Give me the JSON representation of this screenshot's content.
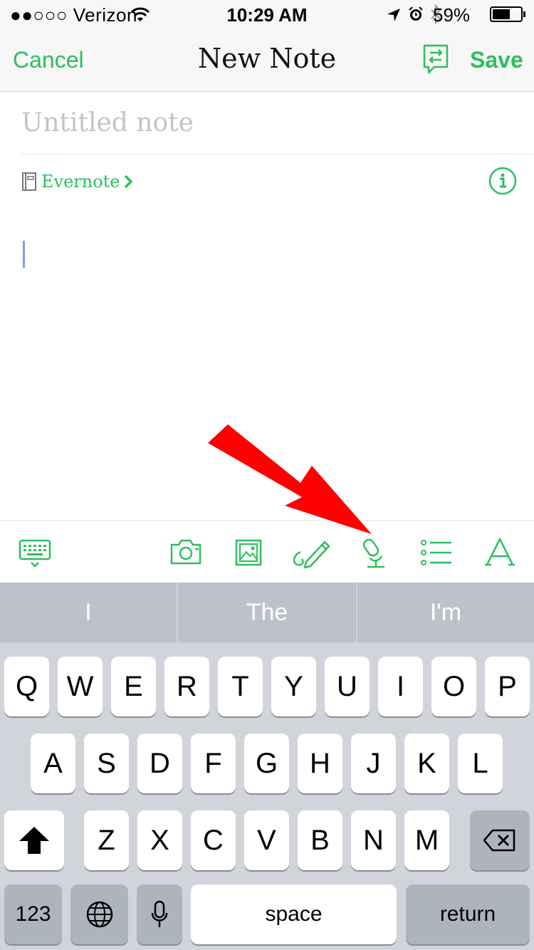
{
  "status_bar": {
    "carrier": "●●○○○ Verizon",
    "time": "10:29 AM",
    "battery": "59%"
  },
  "nav": {
    "cancel": "Cancel",
    "title": "New Note",
    "save": "Save"
  },
  "note": {
    "title_placeholder": "Untitled note",
    "title_value": "",
    "notebook": "Evernote"
  },
  "toolbar": {
    "icons": [
      "keyboard-icon",
      "camera-icon",
      "image-icon",
      "sketch-icon",
      "audio-record-icon",
      "list-icon",
      "text-format-icon"
    ]
  },
  "keyboard": {
    "predictions": [
      "I",
      "The",
      "I'm"
    ],
    "row1": [
      "Q",
      "W",
      "E",
      "R",
      "T",
      "Y",
      "U",
      "I",
      "O",
      "P"
    ],
    "row2": [
      "A",
      "S",
      "D",
      "F",
      "G",
      "H",
      "J",
      "K",
      "L"
    ],
    "row3": [
      "Z",
      "X",
      "C",
      "V",
      "B",
      "N",
      "M"
    ],
    "numbers": "123",
    "space": "space",
    "return": "return"
  },
  "colors": {
    "accent": "#2dbe60",
    "annotation_arrow": "#ff0000"
  }
}
